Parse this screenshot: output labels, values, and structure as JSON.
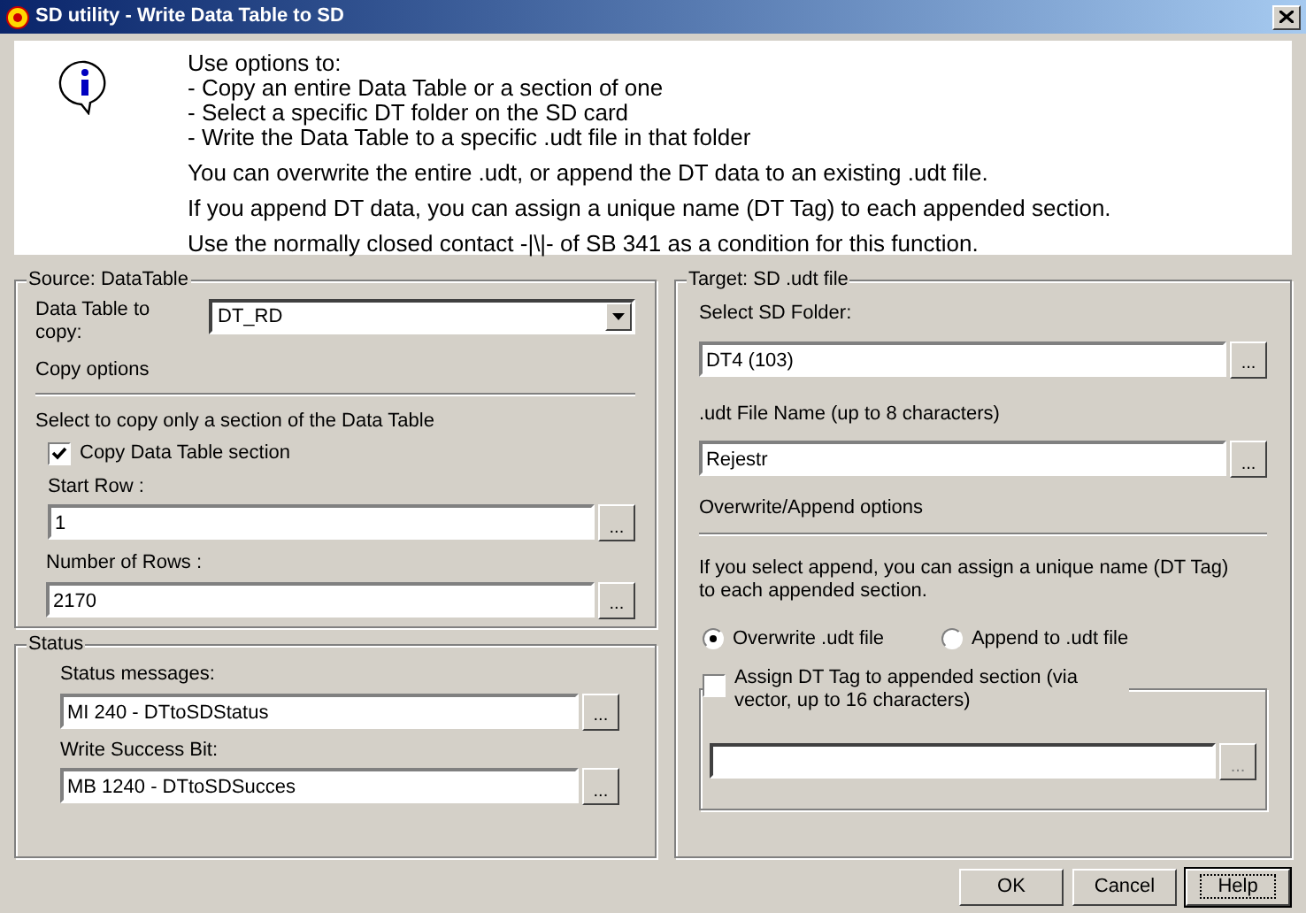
{
  "window": {
    "title": "SD utility - Write Data Table to SD"
  },
  "info": {
    "intro": [
      "Use options to:",
      "- Copy an entire Data Table or a section of one",
      "- Select a specific DT folder on the SD card",
      "- Write the Data Table to a specific .udt file in that folder"
    ],
    "notes": [
      "You can overwrite the entire .udt, or append the DT data to an existing .udt file.",
      "If you append DT data, you can assign a unique name (DT Tag) to each appended section.",
      "Use the normally closed contact -|\\|- of SB 341 as a condition for this function."
    ]
  },
  "source": {
    "title": "Source: DataTable",
    "table_label": "Data Table to copy:",
    "table_value": "DT_RD",
    "copy_options": "Copy options",
    "section_hint": "Select to copy only a section of the Data Table",
    "section_checkbox": {
      "label": "Copy Data Table section",
      "checked": true
    },
    "start_row": {
      "label": "Start Row  :",
      "value": "1",
      "browse": "..."
    },
    "rows": {
      "label": "Number of Rows :",
      "value": "2170",
      "browse": "..."
    }
  },
  "status": {
    "title": "Status",
    "messages": {
      "label": "Status messages:",
      "value": "MI 240  - DTtoSDStatus",
      "browse": "..."
    },
    "success": {
      "label": "Write Success Bit:",
      "value": "MB 1240  - DTtoSDSucces",
      "browse": "..."
    }
  },
  "target": {
    "title": "Target: SD .udt file",
    "folder": {
      "label": "Select SD Folder:",
      "value": "DT4 (103)",
      "browse": "..."
    },
    "file": {
      "label": ".udt File Name (up to 8 characters)",
      "value": "Rejestr",
      "browse": "..."
    },
    "mode_label": "Overwrite/Append options",
    "mode_hint": "If you select append, you can assign a unique name (DT Tag) to each appended section.",
    "modes": [
      {
        "label": "Overwrite .udt file",
        "selected": true
      },
      {
        "label": "Append to .udt file",
        "selected": false
      }
    ],
    "tag": {
      "label": "Assign DT Tag to appended section (via vector, up to 16 characters)",
      "checked": false,
      "browse": "...",
      "browse_disabled": true
    }
  },
  "buttons": [
    {
      "label": "OK",
      "focused": false
    },
    {
      "label": "Cancel",
      "focused": false
    },
    {
      "label": "Help",
      "focused": true
    }
  ]
}
